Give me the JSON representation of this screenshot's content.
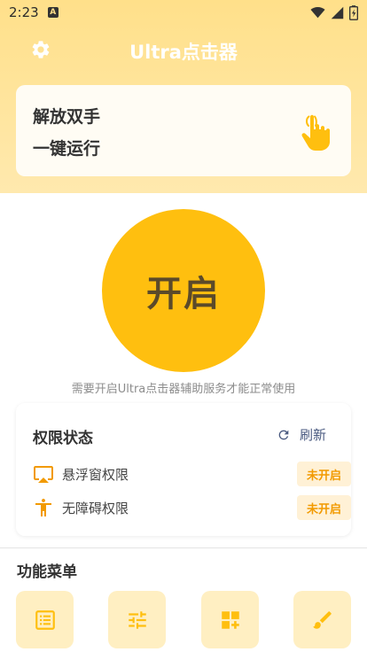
{
  "status_bar": {
    "time": "2:23",
    "notification_letter": "A",
    "icons": [
      "wifi-icon",
      "signal-icon",
      "battery-icon"
    ]
  },
  "app_bar": {
    "title": "Ultra点击器",
    "settings_icon": "gear-icon"
  },
  "slogan": {
    "line1": "解放双手",
    "line2": "一键运行",
    "icon": "touch-hand-icon"
  },
  "start_button": {
    "label": "开启"
  },
  "hint": "需要开启Ultra点击器辅助服务才能正常使用",
  "permissions": {
    "title": "权限状态",
    "refresh_label": "刷新",
    "items": [
      {
        "icon": "airplay-icon",
        "label": "悬浮窗权限",
        "status": "未开启"
      },
      {
        "icon": "accessibility-icon",
        "label": "无障碍权限",
        "status": "未开启"
      }
    ]
  },
  "menu": {
    "title": "功能菜单",
    "items": [
      "list-icon",
      "tune-icon",
      "add-widget-icon",
      "brush-icon"
    ]
  },
  "colors": {
    "accent": "#FFBF0F",
    "header_bg": "#FFE08A",
    "badge_text": "#F29A00",
    "badge_bg": "#FFF1D6"
  }
}
